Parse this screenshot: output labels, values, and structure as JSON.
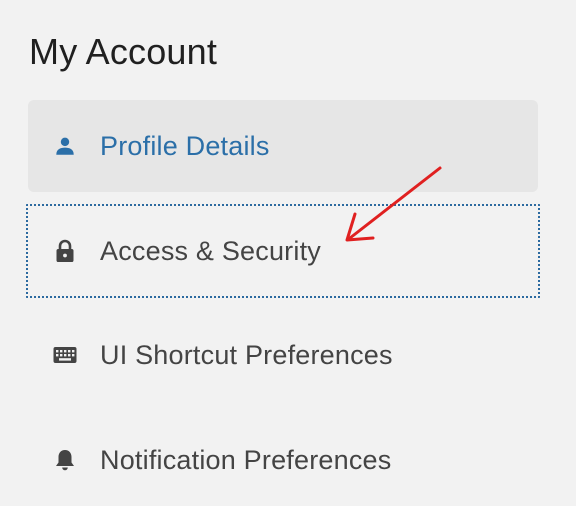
{
  "header": {
    "title": "My Account"
  },
  "sidebar": {
    "items": [
      {
        "label": "Profile Details",
        "icon": "person-icon",
        "state": "active"
      },
      {
        "label": "Access & Security",
        "icon": "lock-icon",
        "state": "focused"
      },
      {
        "label": "UI Shortcut Preferences",
        "icon": "keyboard-icon",
        "state": "default"
      },
      {
        "label": "Notification Preferences",
        "icon": "bell-icon",
        "state": "default"
      }
    ]
  },
  "colors": {
    "background": "#f2f2f2",
    "active_item_background": "#e6e6e6",
    "active_text": "#2b6fa8",
    "text": "#444444",
    "focus_outline": "#2c6aa0",
    "annotation_arrow": "#e02020"
  }
}
